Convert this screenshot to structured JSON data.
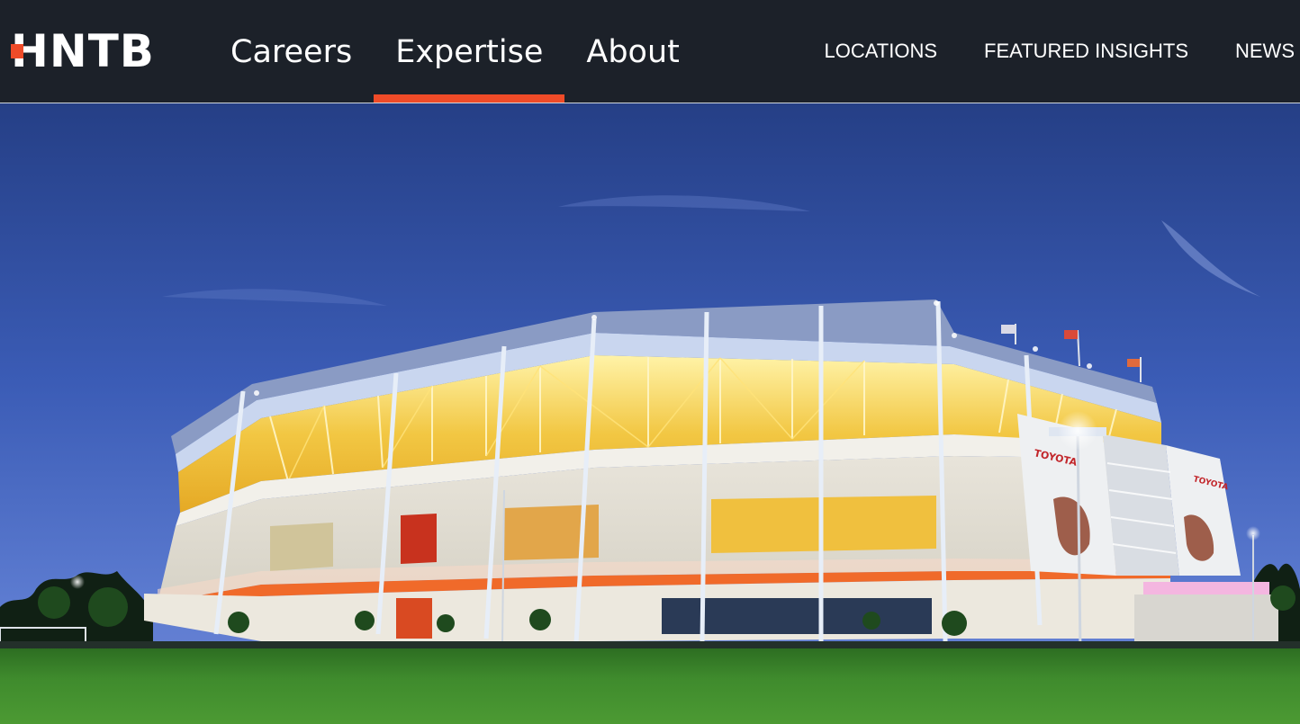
{
  "header": {
    "logo_text": "HNTB",
    "main_nav": [
      {
        "label": "Careers"
      },
      {
        "label": "Expertise"
      },
      {
        "label": "About"
      }
    ],
    "utility_nav": [
      {
        "label": "LOCATIONS"
      },
      {
        "label": "FEATURED INSIGHTS"
      },
      {
        "label": "NEWS"
      }
    ],
    "active_nav": "Expertise"
  },
  "hero": {
    "stadium_sign": "TOYOTA",
    "colors": {
      "sky_top": "#26468f",
      "sky_bottom": "#5573c9",
      "grass": "#3e8a2c",
      "accent": "#ef4b28"
    }
  }
}
